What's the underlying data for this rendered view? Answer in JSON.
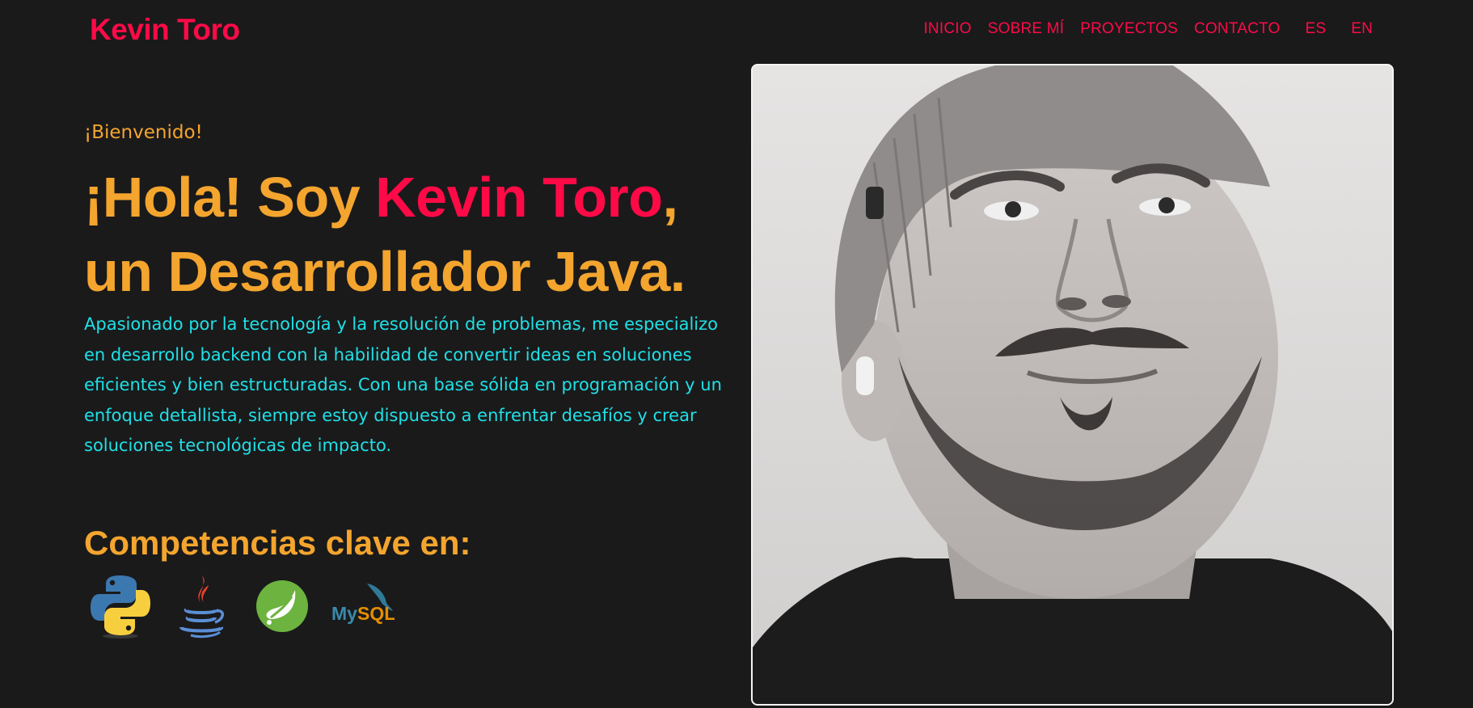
{
  "header": {
    "logo": "Kevin Toro",
    "nav": [
      {
        "label": "INICIO"
      },
      {
        "label": "SOBRE MÍ"
      },
      {
        "label": "PROYECTOS"
      },
      {
        "label": "CONTACTO"
      }
    ],
    "languages": [
      "ES",
      "EN"
    ]
  },
  "hero": {
    "welcome": "¡Bienvenido!",
    "headline_prefix": "¡Hola! Soy ",
    "headline_name": "Kevin Toro",
    "headline_comma": ",",
    "headline_line2": "un Desarrollador Java.",
    "bio": "Apasionado por la tecnología y la resolución de problemas, me especializo en desarrollo backend con la habilidad de convertir ideas en soluciones eficientes y bien estructuradas. Con una base sólida en programación y un enfoque detallista, siempre estoy dispuesto a enfrentar desafíos y crear soluciones tecnológicas de impacto.",
    "skills_title": "Competencias clave en:",
    "skills": [
      {
        "icon": "python-icon",
        "name": "Python"
      },
      {
        "icon": "java-icon",
        "name": "Java"
      },
      {
        "icon": "spring-icon",
        "name": "Spring"
      },
      {
        "icon": "mysql-icon",
        "name": "MySQL",
        "logo_text_1": "My",
        "logo_text_2": "SQL"
      }
    ]
  },
  "photo": {
    "description": "profile-photo"
  },
  "colors": {
    "background": "#1a1a1b",
    "accent_red": "#ff0a47",
    "accent_orange": "#f4a52e",
    "accent_cyan": "#1fe0e6"
  }
}
